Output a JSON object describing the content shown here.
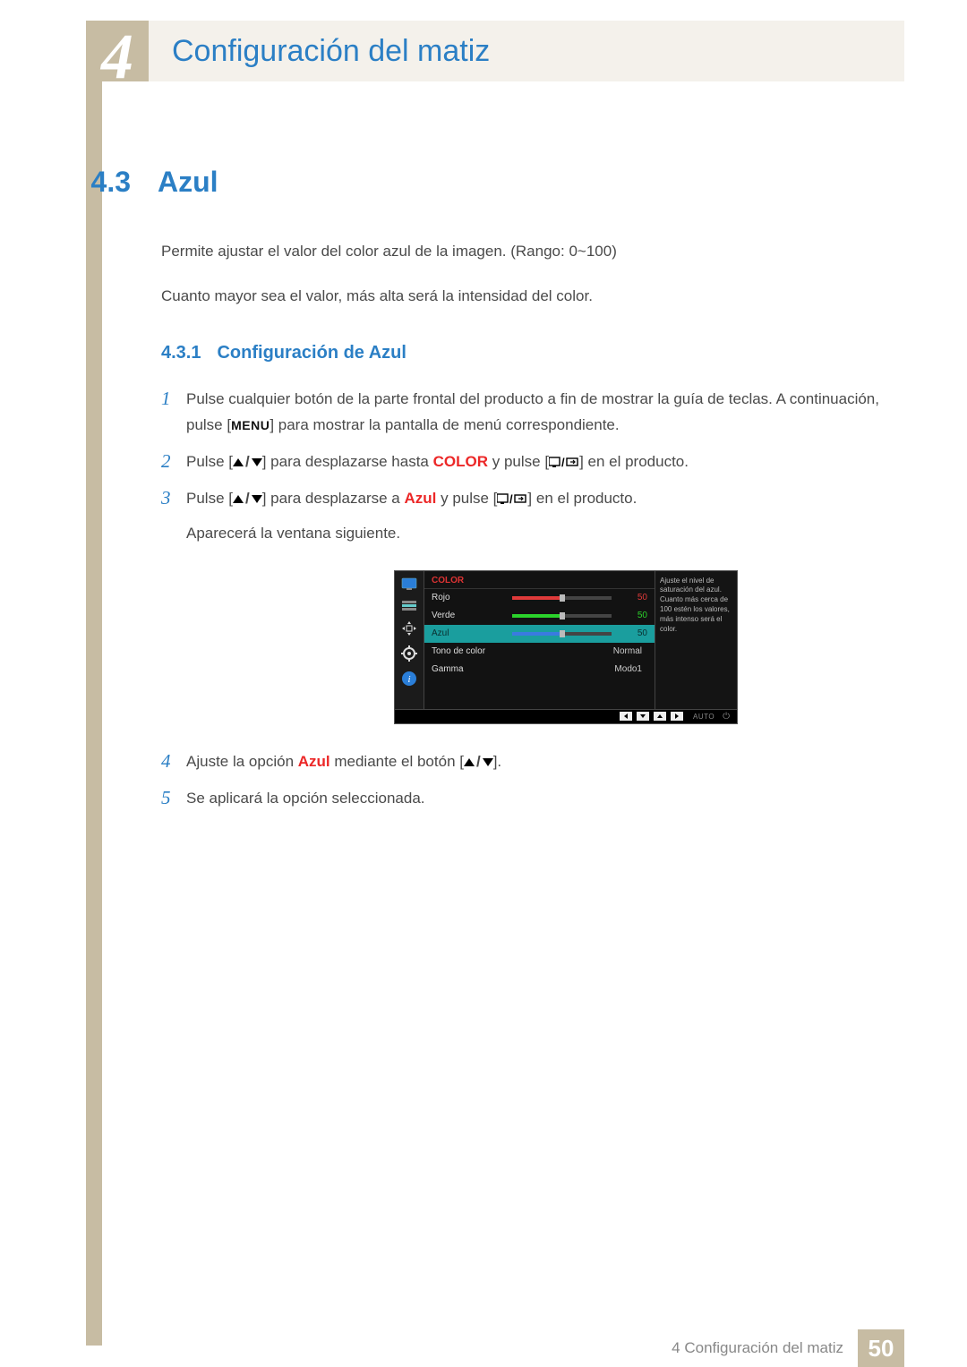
{
  "chapter": {
    "number": "4",
    "title": "Configuración del matiz"
  },
  "section": {
    "number": "4.3",
    "title": "Azul"
  },
  "intro": {
    "p1": "Permite ajustar el valor del color azul de la imagen. (Rango: 0~100)",
    "p2": "Cuanto mayor sea el valor, más alta será la intensidad del color."
  },
  "subsection": {
    "number": "4.3.1",
    "title": "Configuración de Azul"
  },
  "steps": {
    "s1": {
      "num": "1",
      "text_a": "Pulse cualquier botón de la parte frontal del producto a fin de mostrar la guía de teclas. A continuación, pulse [",
      "menu": "MENU",
      "text_b": "] para mostrar la pantalla de menú correspondiente."
    },
    "s2": {
      "num": "2",
      "text_a": "Pulse [",
      "text_b": "] para desplazarse hasta ",
      "kw": "COLOR",
      "text_c": " y pulse [",
      "text_d": "] en el producto."
    },
    "s3": {
      "num": "3",
      "text_a": "Pulse [",
      "text_b": "] para desplazarse a ",
      "kw": "Azul",
      "text_c": " y pulse [",
      "text_d": "] en el producto.",
      "text_e": "Aparecerá la ventana siguiente."
    },
    "s4": {
      "num": "4",
      "text_a": "Ajuste la opción ",
      "kw": "Azul",
      "text_b": " mediante el botón [",
      "text_c": "]."
    },
    "s5": {
      "num": "5",
      "text": "Se aplicará la opción seleccionada."
    }
  },
  "osd": {
    "header": "COLOR",
    "rows": {
      "rojo": {
        "label": "Rojo",
        "value": "50"
      },
      "verde": {
        "label": "Verde",
        "value": "50"
      },
      "azul": {
        "label": "Azul",
        "value": "50"
      },
      "tono": {
        "label": "Tono de color",
        "value": "Normal"
      },
      "gamma": {
        "label": "Gamma",
        "value": "Modo1"
      }
    },
    "help": "Ajuste el nivel de saturación del azul. Cuanto más cerca de 100 estén los valores, más intenso será el color.",
    "auto": "AUTO"
  },
  "footer": {
    "breadcrumb": "4 Configuración del matiz",
    "page": "50"
  }
}
